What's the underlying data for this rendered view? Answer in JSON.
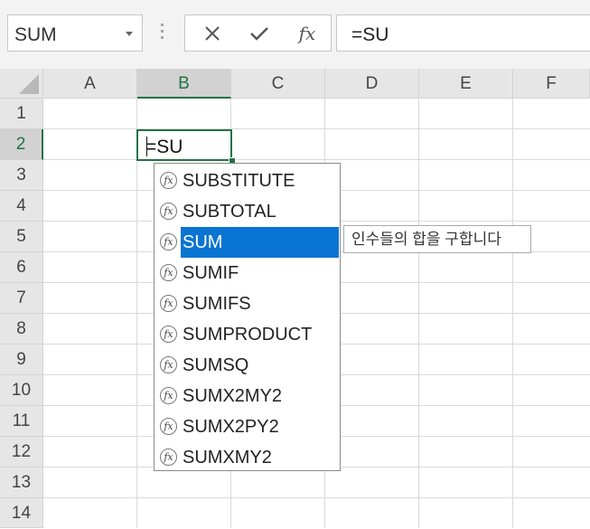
{
  "name_box": {
    "value": "SUM"
  },
  "formula_buttons": {
    "cancel": "✕",
    "enter": "✓",
    "insert_function": "fx"
  },
  "formula_bar": {
    "value": "=SU"
  },
  "columns": [
    "A",
    "B",
    "C",
    "D",
    "E",
    "F"
  ],
  "rows": [
    "1",
    "2",
    "3",
    "4",
    "5",
    "6",
    "7",
    "8",
    "9",
    "10",
    "11",
    "12",
    "13",
    "14"
  ],
  "active_cell": {
    "address": "B2",
    "value": "=SU"
  },
  "autocomplete": {
    "items": [
      "SUBSTITUTE",
      "SUBTOTAL",
      "SUM",
      "SUMIF",
      "SUMIFS",
      "SUMPRODUCT",
      "SUMSQ",
      "SUMX2MY2",
      "SUMX2PY2",
      "SUMXMY2"
    ],
    "selected": "SUM",
    "tooltip": "인수들의 합을 구합니다"
  },
  "colors": {
    "accent": "#217346",
    "selection": "#0a74d2"
  }
}
